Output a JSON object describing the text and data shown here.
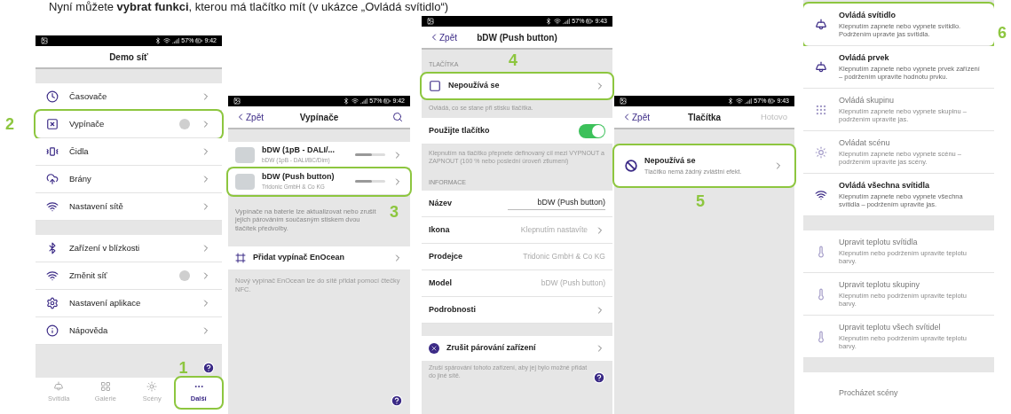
{
  "caption": "Nyní můžete **vybrat funkci**, kterou má tlačítko mít (v ukázce „Ovládá svítidlo“)",
  "demo_screen": {
    "status": {
      "battery": "57%",
      "time": "9:42"
    },
    "title": "Demo síť",
    "sections": [
      {
        "items": [
          {
            "label": "Časovače",
            "kind": "clock",
            "badge": false
          },
          {
            "label": "Vypínače",
            "kind": "switch",
            "badge": true,
            "callout": "2"
          },
          {
            "label": "Čidla",
            "kind": "sensor",
            "badge": false
          },
          {
            "label": "Brány",
            "kind": "gateway",
            "badge": false
          },
          {
            "label": "Nastavení sítě",
            "kind": "wifi",
            "badge": false
          }
        ]
      },
      {
        "items": [
          {
            "label": "Zařízení v blízkosti",
            "kind": "bluetooth",
            "badge": false
          },
          {
            "label": "Změnit síť",
            "kind": "wifi",
            "badge": true
          },
          {
            "label": "Nastavení aplikace",
            "kind": "gear",
            "badge": false
          },
          {
            "label": "Nápověda",
            "kind": "info",
            "badge": false
          }
        ]
      }
    ],
    "tabs": [
      {
        "label": "Svítidla",
        "kind": "lamp",
        "selected": false
      },
      {
        "label": "Galerie",
        "kind": "grid",
        "selected": false
      },
      {
        "label": "Scény",
        "kind": "sun",
        "selected": false
      },
      {
        "label": "Další",
        "kind": "more",
        "selected": true,
        "callout": "1"
      }
    ]
  },
  "switches_screen": {
    "status": {
      "battery": "57%",
      "time": "9:42"
    },
    "back": "Zpět",
    "title": "Vypínače",
    "devices": [
      {
        "name": "bDW (1pB - DALI/...",
        "subtitle": "bDW (1pB - DALI/BC/Dim)",
        "level": 0.55
      },
      {
        "name": "bDW (Push button)",
        "subtitle": "Tridonic GmbH & Co KG",
        "level": 0.55,
        "callout": "3"
      }
    ],
    "note": "Vypínače na baterie lze aktualizovat nebo zrušit jejich párováním současným stiskem dvou tlačítek předvolby.",
    "add_label": "Přidat vypínač EnOcean",
    "add_note": "Nový vypínač EnOcean lze do sítě přidat pomocí čtečky NFC."
  },
  "device_screen": {
    "status": {
      "battery": "57%",
      "time": "9:43"
    },
    "back": "Zpět",
    "title": "bDW (Push button)",
    "buttons_header": "TLAČÍTKA",
    "button": {
      "label": "Nepoužívá se",
      "callout": "4"
    },
    "button_hint": "Ovládá, co se stane při stisku tlačítka.",
    "toggle": {
      "label": "Použijte tlačítko",
      "on": true
    },
    "toggle_hint": "Klepnutím na tlačítko přepnete definovaný cíl mezi VYPNOUT a ZAPNOUT (100 % nebo poslední úroveň ztlumení)",
    "info_header": "INFORMACE",
    "info_rows": [
      {
        "label": "Název",
        "value": "bDW (Push button)",
        "kind": "field"
      },
      {
        "label": "Ikona",
        "value": "Klepnutím nastavíte",
        "kind": "link"
      },
      {
        "label": "Prodejce",
        "value": "Tridonic GmbH & Co KG",
        "kind": "value"
      },
      {
        "label": "Model",
        "value": "bDW (Push button)",
        "kind": "value"
      },
      {
        "label": "Podrobnosti",
        "kind": "link"
      }
    ],
    "unpair": "Zrušit párování zařízení",
    "unpair_note": "Zruší spárování tohoto zařízení, aby jej bylo možné přidat do jiné sítě."
  },
  "buttons_screen": {
    "status": {
      "battery": "57%",
      "time": "9:43"
    },
    "back": "Zpět",
    "title": "Tlačítka",
    "done": "Hotovo",
    "option": {
      "title": "Nepoužívá se",
      "subtitle": "Tlačítko nemá žádný zvláštní efekt.",
      "callout": "5"
    }
  },
  "functions_screen": {
    "groups": [
      {
        "options": [
          {
            "title": "Ovládá svítidlo",
            "description": "Klepnutím zapnete nebo vypnete svítidlo. Podržením upravte jas svítidla.",
            "kind": "lamp",
            "disabled": false,
            "callout": "6"
          },
          {
            "title": "Ovládá prvek",
            "description": "Klepnutím zapnete nebo vypnete prvek zařízení – podržením upravíte hodnotu prvku.",
            "kind": "lamp",
            "disabled": false
          },
          {
            "title": "Ovládá skupinu",
            "description": "Klepnutím zapnete nebo vypnete skupinu – podržením upravíte jas.",
            "kind": "group",
            "disabled": true
          },
          {
            "title": "Ovládat scénu",
            "description": "Klepnutím zapnete nebo vypnete scénu – podržením upravíte jas scény.",
            "kind": "sun",
            "disabled": true
          },
          {
            "title": "Ovládá všechna svítidla",
            "description": "Klepnutím zapnete nebo vypnete všechna svítidla – podržením upravíte jas.",
            "kind": "wifi",
            "disabled": false
          }
        ]
      },
      {
        "options": [
          {
            "title": "Upravit teplotu svítidla",
            "description": "Klepnutím nebo podržením upravíte teplotu barvy.",
            "kind": "thermometer",
            "disabled": true
          },
          {
            "title": "Upravit teplotu skupiny",
            "description": "Klepnutím nebo podržením upravíte teplotu barvy.",
            "kind": "thermometer",
            "disabled": true
          },
          {
            "title": "Upravit teplotu všech svítidel",
            "description": "Klepnutím nebo podržením upravíte teplotu barvy.",
            "kind": "thermometer",
            "disabled": true
          }
        ]
      },
      {
        "options": [
          {
            "title": "Procházet scény",
            "disabled": true
          }
        ]
      }
    ]
  }
}
